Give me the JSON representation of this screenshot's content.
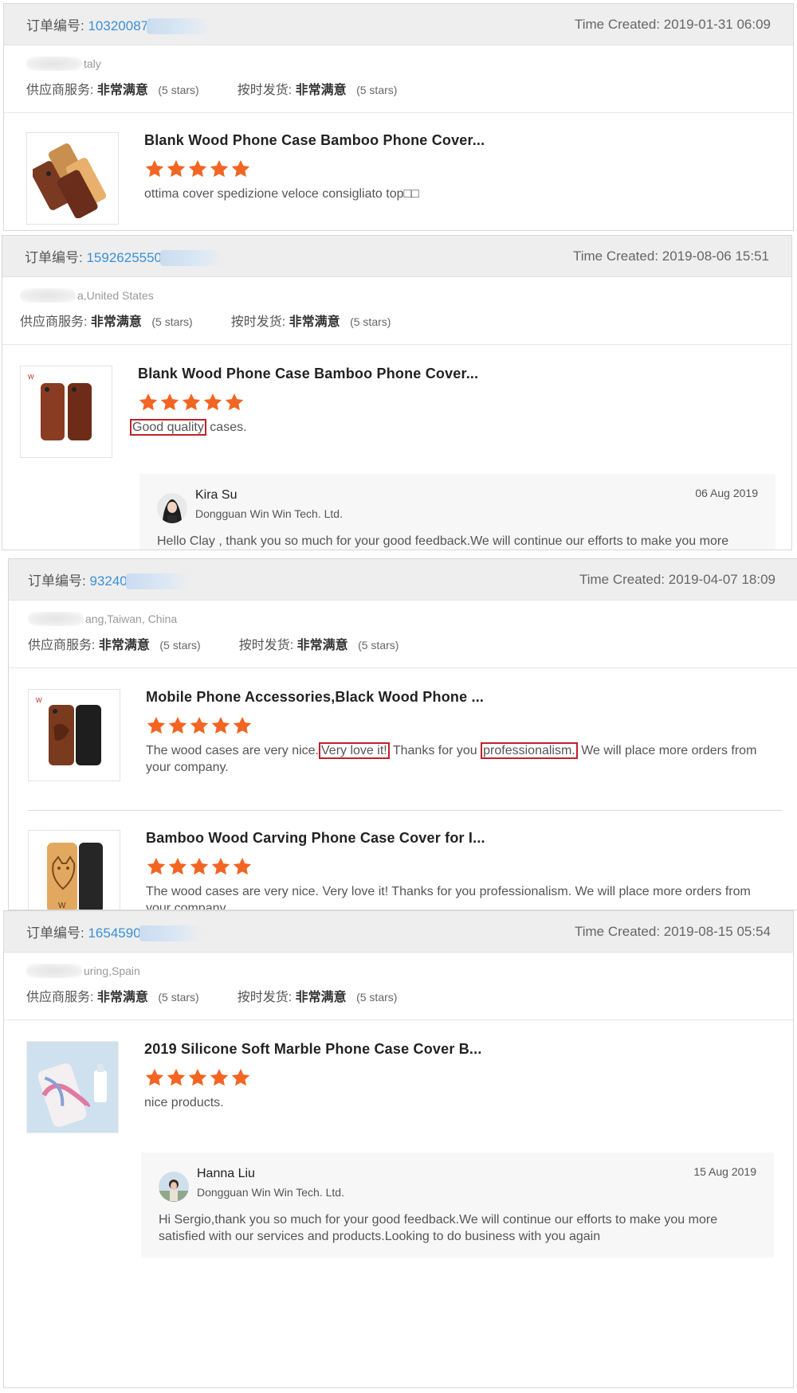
{
  "colors": {
    "accent_link": "#3a8fd8",
    "star": "#f26522",
    "highlight_box": "#c0212b"
  },
  "stars_count": 5,
  "orders": [
    {
      "order_label": "订单编号:",
      "order_no": "10320087",
      "time_created": "Time Created: 2019-01-31 06:09",
      "location": "taly",
      "supplier_service_label": "供应商服务:",
      "supplier_service_value": "非常满意",
      "supplier_service_stars": "(5 stars)",
      "on_time_label": "按时发货:",
      "on_time_value": "非常满意",
      "on_time_stars": "(5 stars)",
      "products": [
        {
          "title": "Blank Wood Phone Case Bamboo Phone Cover...",
          "comment": "ottima cover spedizione veloce  consigliato top□□"
        }
      ]
    },
    {
      "order_label": "订单编号:",
      "order_no": "1592625550",
      "time_created": "Time Created: 2019-08-06 15:51",
      "location": "a,United States",
      "supplier_service_label": "供应商服务:",
      "supplier_service_value": "非常满意",
      "supplier_service_stars": "(5 stars)",
      "on_time_label": "按时发货:",
      "on_time_value": "非常满意",
      "on_time_stars": "(5 stars)",
      "products": [
        {
          "title": "Blank Wood Phone Case Bamboo Phone Cover...",
          "comment_hl": "Good quality",
          "comment_rest": " cases."
        }
      ],
      "reply": {
        "name": "Kira Su",
        "company": "Dongguan Win Win Tech. Ltd.",
        "date": "06 Aug 2019",
        "text": "Hello Clay , thank you so much for your good feedback.We will continue our efforts to make you more satisfied with our services and products.Looking to do business with you again"
      }
    },
    {
      "order_label": "订单编号:",
      "order_no": "93240",
      "time_created": "Time Created: 2019-04-07 18:09",
      "location": "ang,Taiwan, China",
      "supplier_service_label": "供应商服务:",
      "supplier_service_value": "非常满意",
      "supplier_service_stars": "(5 stars)",
      "on_time_label": "按时发货:",
      "on_time_value": "非常满意",
      "on_time_stars": "(5 stars)",
      "products": [
        {
          "title": "Mobile Phone Accessories,Black Wood Phone ...",
          "comment_a": "The wood cases are very nice.",
          "comment_hl1": "Very love it!",
          "comment_b": " Thanks for you ",
          "comment_hl2": "professionalism.",
          "comment_c": " We will place more orders from your company."
        },
        {
          "title": "Bamboo Wood Carving Phone Case Cover for I...",
          "comment": "The wood cases are very nice. Very love it! Thanks for you professionalism. We will place more orders from your company."
        }
      ]
    },
    {
      "order_label": "订单编号:",
      "order_no": "1654590",
      "time_created": "Time Created: 2019-08-15 05:54",
      "location": "uring,Spain",
      "supplier_service_label": "供应商服务:",
      "supplier_service_value": "非常满意",
      "supplier_service_stars": "(5 stars)",
      "on_time_label": "按时发货:",
      "on_time_value": "非常满意",
      "on_time_stars": "(5 stars)",
      "products": [
        {
          "title": "2019 Silicone Soft Marble Phone Case Cover B...",
          "comment": "nice products."
        }
      ],
      "reply": {
        "name": "Hanna Liu",
        "company": "Dongguan Win Win Tech. Ltd.",
        "date": "15 Aug 2019",
        "text": "Hi Sergio,thank you so much for your good feedback.We will continue our efforts to make you more satisfied with our services and products.Looking to do business with you again"
      }
    }
  ]
}
